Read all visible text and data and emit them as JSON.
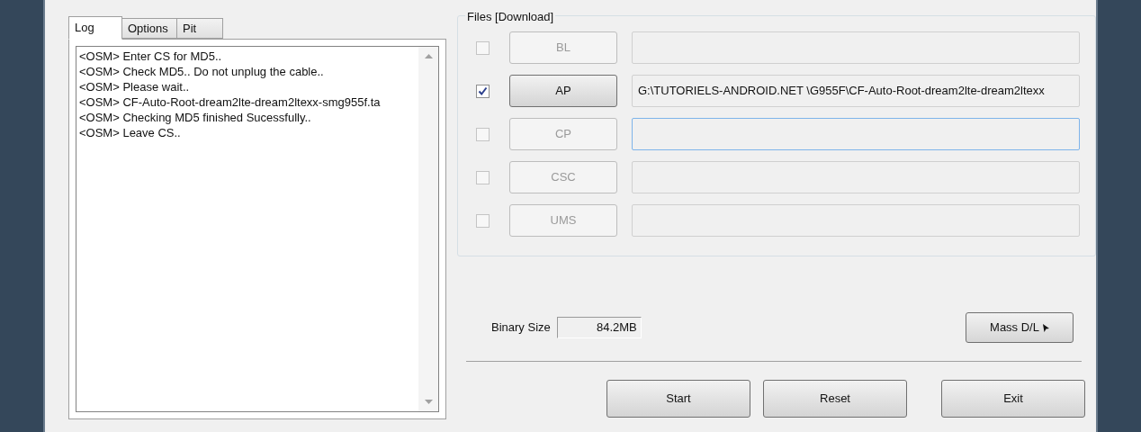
{
  "tabs": [
    {
      "label": "Log",
      "selected": true
    },
    {
      "label": "Options",
      "selected": false
    },
    {
      "label": "Pit",
      "selected": false
    }
  ],
  "log": [
    "<OSM> Enter CS for MD5..",
    "<OSM> Check MD5.. Do not unplug the cable..",
    "<OSM> Please wait..",
    "<OSM> CF-Auto-Root-dream2lte-dream2ltexx-smg955f.ta",
    "<OSM> Checking MD5 finished Sucessfully..",
    "<OSM> Leave CS.."
  ],
  "files": {
    "title": "Files [Download]",
    "rows": [
      {
        "label": "BL",
        "checked": false,
        "disabled": true,
        "focused": false
      },
      {
        "label": "AP",
        "checked": true,
        "disabled": false,
        "focused": false,
        "value": "G:\\TUTORIELS-ANDROID.NET \\G955F\\CF-Auto-Root-dream2lte-dream2ltexx"
      },
      {
        "label": "CP",
        "checked": false,
        "disabled": true,
        "focused": true
      },
      {
        "label": "CSC",
        "checked": false,
        "disabled": true,
        "focused": false
      },
      {
        "label": "UMS",
        "checked": false,
        "disabled": true,
        "focused": false
      }
    ]
  },
  "binary_size": {
    "label": "Binary Size",
    "value": "84.2MB"
  },
  "mass_dl": "Mass D/L",
  "buttons": [
    "Start",
    "Reset",
    "Exit"
  ]
}
